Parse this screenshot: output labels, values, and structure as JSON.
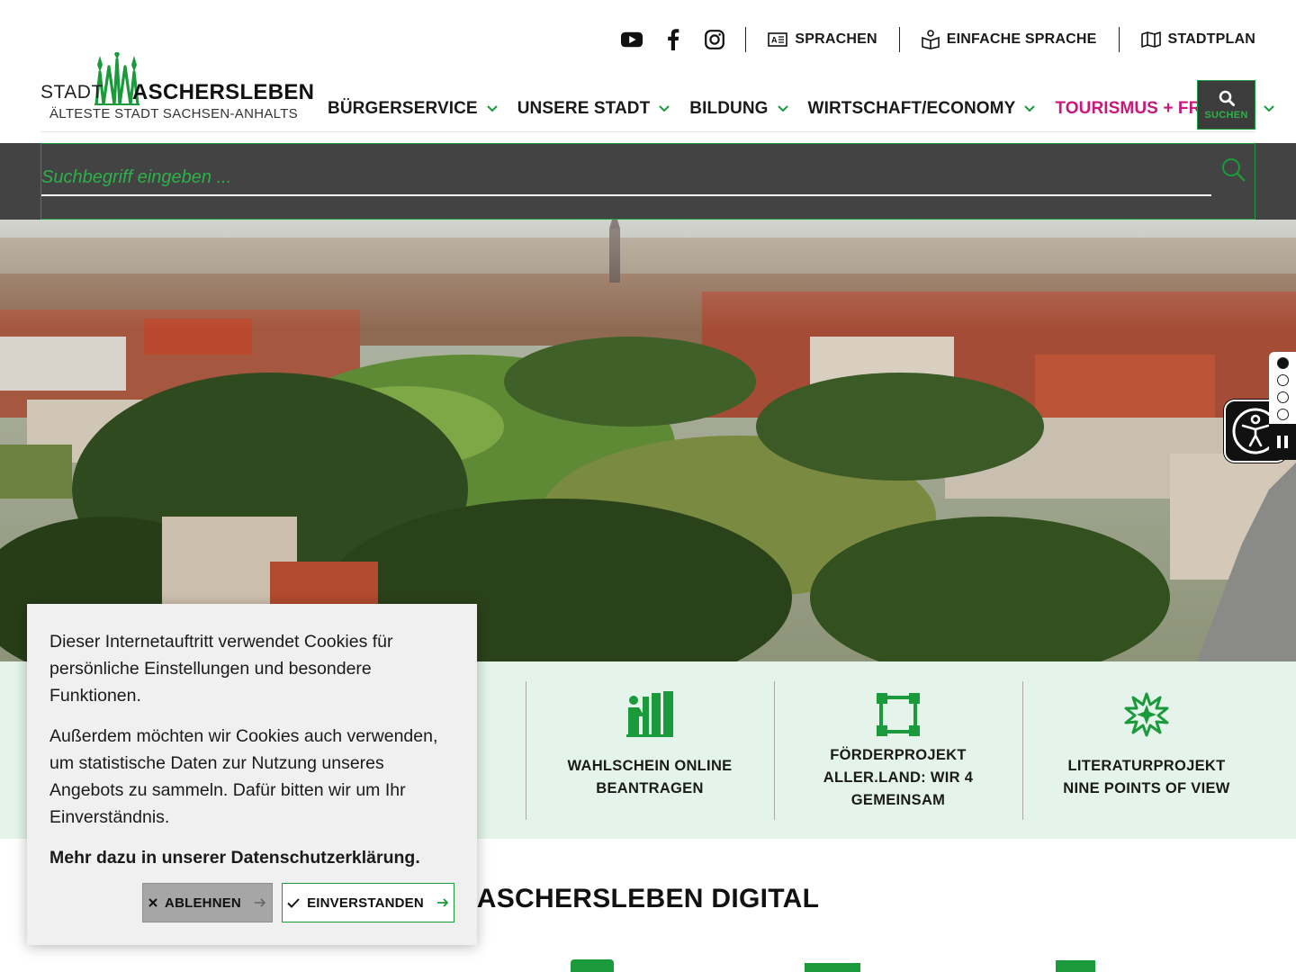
{
  "header": {
    "social": [
      "youtube-icon",
      "facebook-icon",
      "instagram-icon"
    ],
    "links": [
      {
        "label": "SPRACHEN",
        "icon": "language-icon"
      },
      {
        "label": "EINFACHE SPRACHE",
        "icon": "book-reader-icon"
      },
      {
        "label": "STADTPLAN",
        "icon": "map-icon"
      }
    ],
    "logo": {
      "word1": "STADT",
      "word2": "ASCHERSLEBEN",
      "tagline": "ÄLTESTE STADT SACHSEN-ANHALTS"
    },
    "nav": [
      {
        "label": "BÜRGERSERVICE"
      },
      {
        "label": "UNSERE STADT"
      },
      {
        "label": "BILDUNG"
      },
      {
        "label": "WIRTSCHAFT/ECONOMY"
      },
      {
        "label": "TOURISMUS + FREIZEIT",
        "active": true
      }
    ],
    "search_button": "SUCHEN"
  },
  "search": {
    "placeholder": "Suchbegriff eingeben ..."
  },
  "slider": {
    "slide_count": 4,
    "active_slide": 1
  },
  "quicklinks": [
    {
      "label": "WAHLSCHEIN ONLINE\nBEANTRAGEN",
      "icon": "voting-booth-icon"
    },
    {
      "label": "FÖRDERPROJEKT\nALLER.LAND: WIR 4\nGEMEINSAM",
      "icon": "vector-square-icon"
    },
    {
      "label": "LITERATURPROJEKT\nNINE POINTS OF VIEW",
      "icon": "starburst-icon"
    }
  ],
  "section": {
    "title": "ASCHERSLEBEN DIGITAL"
  },
  "cookie": {
    "text1": "Dieser Internetauftritt verwendet Cookies für persönliche Einstellungen und besondere Funktionen.",
    "text2": "Außerdem möchten wir Cookies auch verwenden, um statistische Daten zur Nutzung unseres Angebots zu sammeln. Dafür bitten wir um Ihr Einverständnis.",
    "link": "Mehr dazu in unserer Datenschutzerklärung.",
    "reject": "ABLEHNEN",
    "accept": "EINVERSTANDEN"
  },
  "colors": {
    "brand_green": "#1a9a3a",
    "accent_magenta": "#c8197a",
    "band_bg": "#e4f4ea",
    "search_bg": "#434343"
  }
}
